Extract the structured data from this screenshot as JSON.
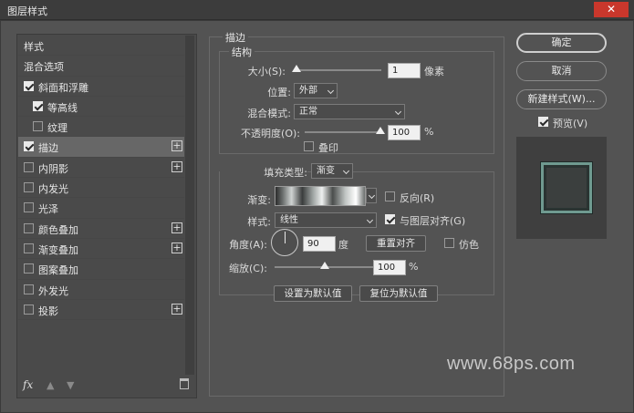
{
  "window": {
    "title": "图层样式",
    "close_glyph": "✕"
  },
  "sidebar": {
    "items": [
      {
        "label": "样式",
        "checkbox": false,
        "checked": false,
        "plus": false,
        "indent": 0,
        "selected": false
      },
      {
        "label": "混合选项",
        "checkbox": false,
        "checked": false,
        "plus": false,
        "indent": 0,
        "selected": false
      },
      {
        "label": "斜面和浮雕",
        "checkbox": true,
        "checked": true,
        "plus": false,
        "indent": 0,
        "selected": false
      },
      {
        "label": "等高线",
        "checkbox": true,
        "checked": true,
        "plus": false,
        "indent": 1,
        "selected": false
      },
      {
        "label": "纹理",
        "checkbox": true,
        "checked": false,
        "plus": false,
        "indent": 1,
        "selected": false
      },
      {
        "label": "描边",
        "checkbox": true,
        "checked": true,
        "plus": true,
        "indent": 0,
        "selected": true
      },
      {
        "label": "内阴影",
        "checkbox": true,
        "checked": false,
        "plus": true,
        "indent": 0,
        "selected": false
      },
      {
        "label": "内发光",
        "checkbox": true,
        "checked": false,
        "plus": false,
        "indent": 0,
        "selected": false
      },
      {
        "label": "光泽",
        "checkbox": true,
        "checked": false,
        "plus": false,
        "indent": 0,
        "selected": false
      },
      {
        "label": "颜色叠加",
        "checkbox": true,
        "checked": false,
        "plus": true,
        "indent": 0,
        "selected": false
      },
      {
        "label": "渐变叠加",
        "checkbox": true,
        "checked": false,
        "plus": true,
        "indent": 0,
        "selected": false
      },
      {
        "label": "图案叠加",
        "checkbox": true,
        "checked": false,
        "plus": false,
        "indent": 0,
        "selected": false
      },
      {
        "label": "外发光",
        "checkbox": true,
        "checked": false,
        "plus": false,
        "indent": 0,
        "selected": false
      },
      {
        "label": "投影",
        "checkbox": true,
        "checked": false,
        "plus": true,
        "indent": 0,
        "selected": false
      }
    ],
    "footer": {
      "fx_label": "fx",
      "up_glyph": "▲",
      "down_glyph": "▼"
    }
  },
  "stroke": {
    "section_title": "描边",
    "structure": {
      "title": "结构",
      "size_label": "大小(S):",
      "size_value": "1",
      "size_unit": "像素",
      "size_slider_fraction": 0.02,
      "position_label": "位置:",
      "position_value": "外部",
      "blend_label": "混合模式:",
      "blend_value": "正常",
      "opacity_label": "不透明度(O):",
      "opacity_value": "100",
      "opacity_unit": "%",
      "opacity_slider_fraction": 1.0,
      "overprint_label": "叠印",
      "overprint_checked": false
    },
    "fill": {
      "type_label": "填充类型:",
      "type_value": "渐变",
      "gradient_label": "渐变:",
      "reverse_label": "反向(R)",
      "reverse_checked": false,
      "style_label": "样式:",
      "style_value": "线性",
      "align_label": "与图层对齐(G)",
      "align_checked": true,
      "angle_label": "角度(A):",
      "angle_value": "90",
      "angle_unit": "度",
      "reset_align_label": "重置对齐",
      "dither_label": "仿色",
      "dither_checked": false,
      "scale_label": "缩放(C):",
      "scale_value": "100",
      "scale_unit": "%",
      "scale_slider_fraction": 0.5
    },
    "set_default_label": "设置为默认值",
    "reset_default_label": "复位为默认值"
  },
  "actions": {
    "ok_label": "确定",
    "cancel_label": "取消",
    "new_style_label": "新建样式(W)...",
    "preview_label": "预览(V)",
    "preview_checked": true
  },
  "watermark": "www.68ps.com",
  "colors": {
    "panel": "#535353",
    "selected_row": "#676767",
    "close": "#c9372c",
    "preview_stroke": "#6f9a90"
  }
}
